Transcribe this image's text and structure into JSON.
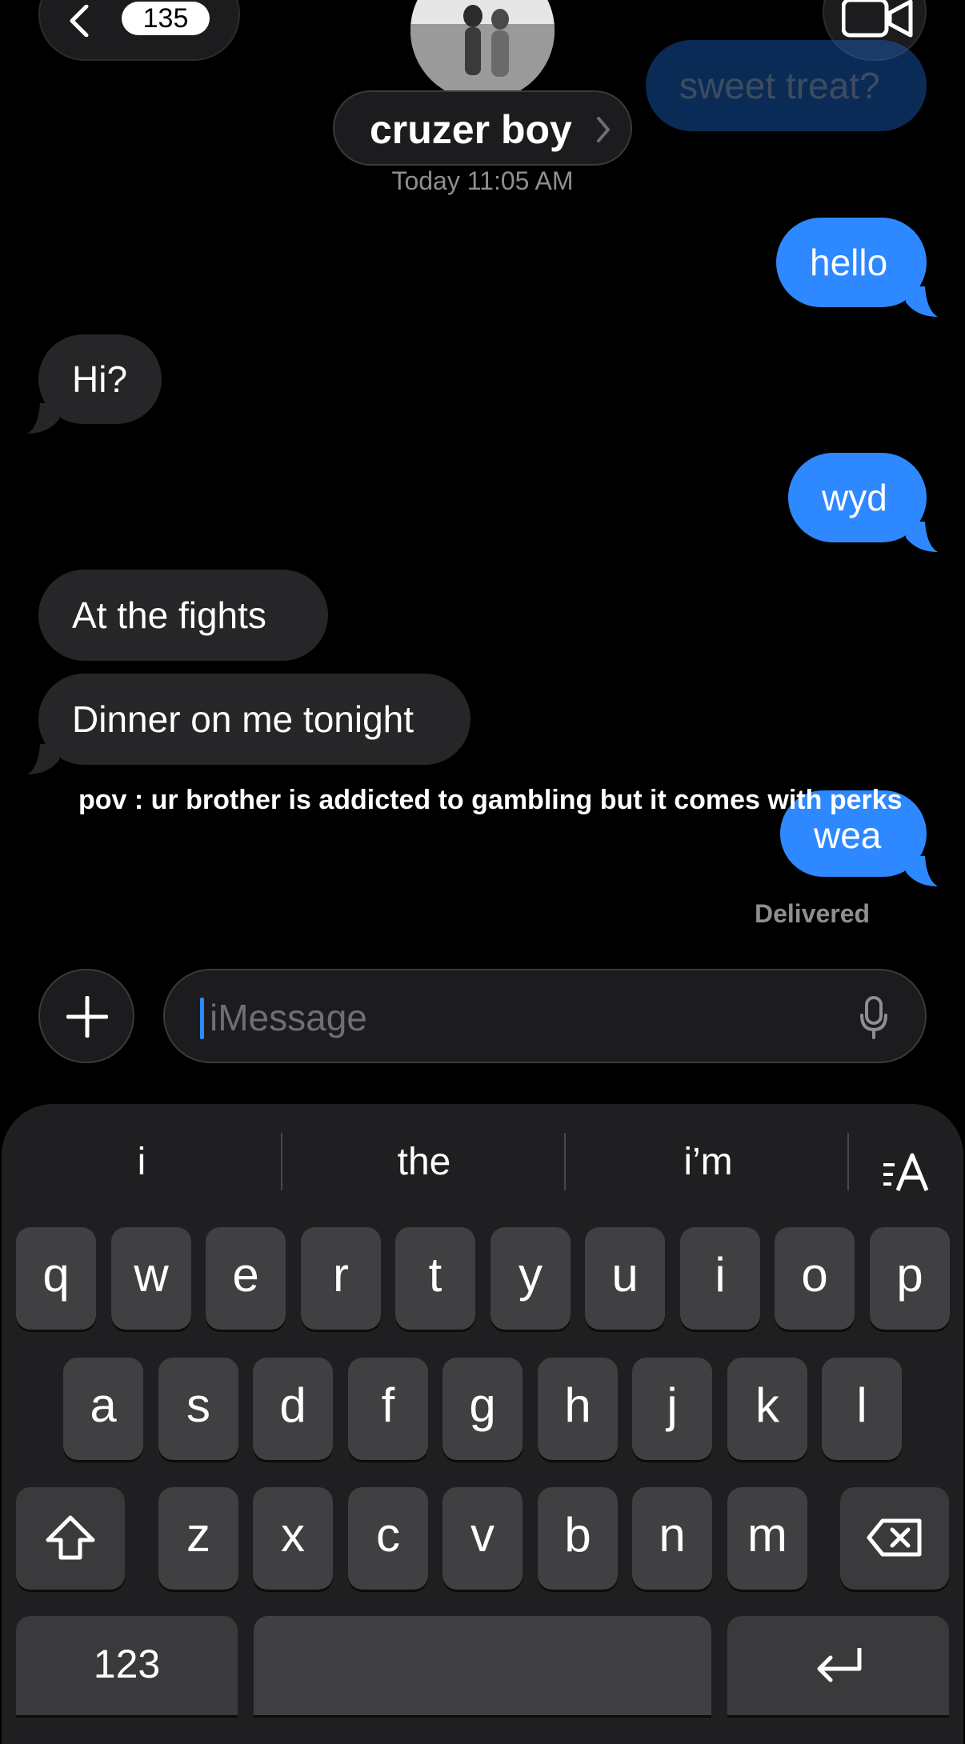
{
  "header": {
    "back_count": "135",
    "contact_name": "cruzer boy",
    "timestamp": "Today 11:05 AM"
  },
  "messages": [
    {
      "text": "sweet treat?",
      "direction": "out",
      "faded": true
    },
    {
      "text": "hello",
      "direction": "out"
    },
    {
      "text": "Hi?",
      "direction": "in"
    },
    {
      "text": "wyd",
      "direction": "out"
    },
    {
      "text": "At the fights",
      "direction": "in"
    },
    {
      "text": "Dinner on me tonight",
      "direction": "in"
    },
    {
      "text": "wea",
      "direction": "out"
    }
  ],
  "caption": "pov : ur brother is addicted to gambling but it comes with perks",
  "status": "Delivered",
  "input": {
    "placeholder": "iMessage"
  },
  "keyboard": {
    "suggestions": [
      "i",
      "the",
      "i’m"
    ],
    "row1": [
      "q",
      "w",
      "e",
      "r",
      "t",
      "y",
      "u",
      "i",
      "o",
      "p"
    ],
    "row2": [
      "a",
      "s",
      "d",
      "f",
      "g",
      "h",
      "j",
      "k",
      "l"
    ],
    "row3": [
      "z",
      "x",
      "c",
      "v",
      "b",
      "n",
      "m"
    ],
    "numbers_label": "123"
  },
  "colors": {
    "outgoing_bubble": "#2e88ff",
    "incoming_bubble": "#262628",
    "background": "#000000"
  }
}
